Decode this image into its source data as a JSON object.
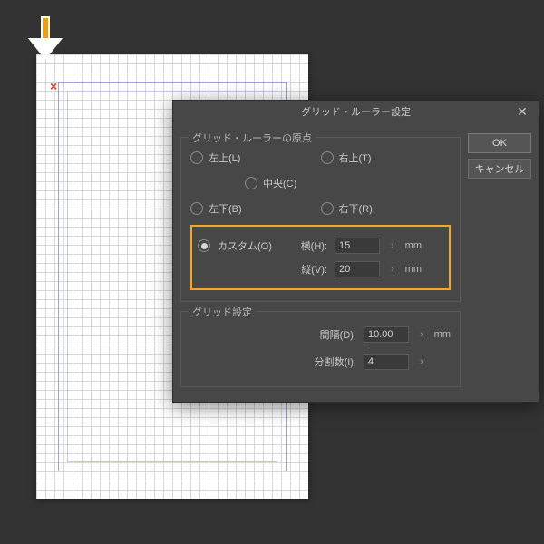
{
  "dialog": {
    "title": "グリッド・ルーラー設定",
    "buttons": {
      "ok": "OK",
      "cancel": "キャンセル"
    }
  },
  "origin": {
    "legend": "グリッド・ルーラーの原点",
    "topLeft": "左上(L)",
    "topRight": "右上(T)",
    "center": "中央(C)",
    "bottomLeft": "左下(B)",
    "bottomRight": "右下(R)",
    "custom": "カスタム(O)",
    "hLabel": "横(H):",
    "hValue": "15",
    "vLabel": "縦(V):",
    "vValue": "20",
    "unit": "mm"
  },
  "grid": {
    "legend": "グリッド設定",
    "spacingLabel": "間隔(D):",
    "spacingValue": "10.00",
    "spacingUnit": "mm",
    "divisionLabel": "分割数(I):",
    "divisionValue": "4"
  }
}
